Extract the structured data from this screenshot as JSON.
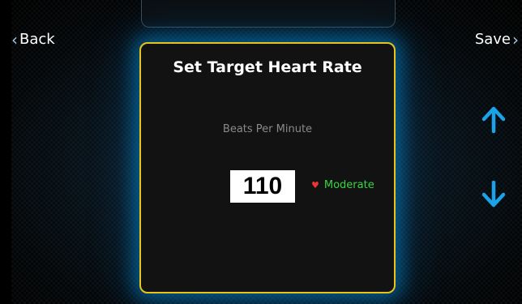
{
  "nav": {
    "back_label": "Back",
    "save_label": "Save",
    "back_icon": "chevron-left-icon",
    "save_icon": "chevron-right-icon"
  },
  "dialog": {
    "title": "Set Target Heart Rate",
    "unit_label": "Beats Per Minute",
    "value": "110",
    "zone_label": "Moderate",
    "zone_icon": "heart-icon"
  },
  "controls": {
    "up_icon": "arrow-up-icon",
    "down_icon": "arrow-down-icon"
  },
  "colors": {
    "dialog_border": "#e6c51a",
    "arrow": "#1aa3e8",
    "zone_text": "#39d444",
    "heart": "#e33333",
    "glow": "#0096e6"
  }
}
